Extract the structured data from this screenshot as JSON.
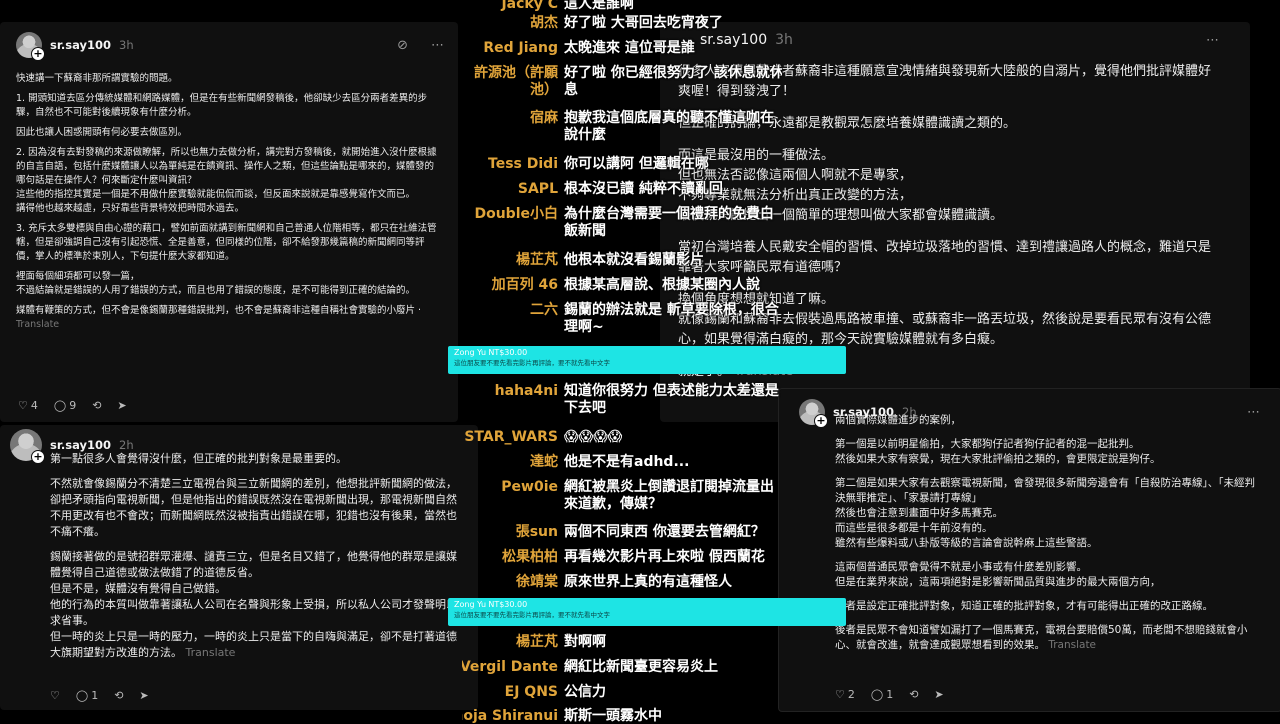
{
  "post_left_top": {
    "username": "sr.say100",
    "time": "3h",
    "paragraphs": [
      "快速講一下蘇裔非那所謂實驗的問題。",
      "1. 開頭知道去區分傳統媒體和網路媒體，但是在有些新聞網發稿後，他卻缺少去區分兩者差異的步驟，自然也不可能對後續現象有什麼分析。",
      "因此也讓人困惑開頭有何必要去做區別。",
      "2. 因為沒有去對發稿的來源做瞭解，所以也無力去做分析，講完對方發稿後，就開始進入沒什麼根據的自言自語，包括什麼媒體讓人以為單純是在饋資訊、操作人之類，但這些論點是哪來的，媒體發的哪句話是在操作人？何來斷定什麼叫資訊？\n這些他的指控其實是一個是不用做什麼實驗就能侃侃而談，但反面來說就是靠感覺寫作文而已。\n講得他也越來越虛，只好靠些背景特效把時間水過去。",
      "3. 充斥太多雙標與自由心證的藉口，譬如前面就講到新聞網和自己普通人位階相等，都只在社維法管轄，但是卻強調自己沒有引起恐慌、全是善意，但同樣的位階，卻不給發那幾篇稿的新聞網同等評價，掌人的標準於束別人，下句提什麼大家都知道。",
      "裡面每個細項都可以發一篇，\n不過結論就是錯誤的人用了錯誤的方式，而且也用了錯誤的態度，是不可能得到正確的結論的。",
      "媒體有鞭策的方式，但不會是像錫蘭那種錯誤批判，也不會是蘇裔非這種自稱社會實驗的小廢片"
    ],
    "translate": "Translate",
    "likes": "4",
    "comments": "9"
  },
  "post_left_bottom": {
    "username": "sr.say100",
    "time": "2h",
    "paragraphs": [
      "第一點很多人會覺得沒什麼，但正確的批判對象是最重要的。",
      "不然就會像錫蘭分不清楚三立電視台與三立新聞網的差別，他想批評新聞網的做法，卻把矛頭指向電視新聞，但是他指出的錯誤既然沒在電視新聞出現，那電視新聞自然不用更改有也不會改；而新聞網既然沒被指責出錯誤在哪，犯錯也沒有後果，當然也不痛不癢。",
      "錫蘭接著做的是號招群眾灌爆、譴責三立，但是名目又錯了，他覺得他的群眾是讓媒體覺得自己道德或做法做錯了的道德反省。\n但是不是，媒體沒有覺得自己做錯。\n他的行為的本質叫做靠著讓私人公司在名聲與形象上受損，所以私人公司才發聲明以求省事。\n但一時的炎上只是一時的壓力，一時的炎上只是當下的自嗨與滿足，卻不是打著道德大旗期望對方改進的方法。"
    ],
    "translate": "Translate",
    "comments": "1"
  },
  "post_mid": {
    "username": "sr.say100",
    "time": "3h",
    "paragraphs": [
      "很多人宣傳錫蘭或者蘇裔非這種願意宣洩情緒與發現新大陸般的自溺片，覺得他們批評媒體好爽喔！得到發洩了！",
      "但正確的討論，永遠都是教觀眾怎麼培養媒體識讀之類的。",
      "而這是最沒用的一種做法。\n但也無法否認像這兩個人啊就不是專家，\n不夠專業就無法分析出真正改變的方法，\n最後就只能提出一個簡單的理想叫做大家都會媒體識讀。",
      "當初台灣培養人民戴安全帽的習慣、改掉垃圾落地的習慣、達到禮讓過路人的概念，難道只是靠著大家呼籲民眾有道德嗎？",
      "換個角度想想就知道了嘛。\n就像錫蘭和蘇裔非去假裝過馬路被車撞、或蘇裔非一路丟垃圾，然後說是要看民眾有沒有公德心，如果覺得滿白癡的，那今天說實驗媒體就有多白癡。",
      "就是了。"
    ],
    "translate": "Translate"
  },
  "post_right": {
    "username": "sr.say100",
    "time": "2h",
    "paragraphs": [
      "兩個實際媒體進步的案例，",
      "第一個是以前明星偷拍，大家都狗仔記者狗仔記者的混一起批判。\n然後如果大家有察覺，現在大家批評偷拍之類的，會更限定說是狗仔。",
      "第二個是如果大家有去觀察電視新聞，會發現很多新聞旁邊會有「自殺防治專線」、「未經判決無罪推定」、「家暴請打專線」\n然後也會注意到畫面中好多馬賽克。\n而這些是很多都是十年前沒有的。\n雖然有些爆料或八卦版等級的言論會說幹麻上這些警語。",
      "這兩個普通民眾會覺得不就是小事或有什麼差別影響。\n但是在業界來說，這兩項絕對是影響新聞品質與進步的最大兩個方向，",
      "後者是設定正確批評對象，知道正確的批評對象，才有可能得出正確的改正路線。",
      "後者是民眾不會知道譬如漏打了一個馬賽克，電視台要賠償50萬，而老闆不想賠錢就會小心、就會改進，就會達成觀眾想看到的效果。"
    ],
    "translate": "Translate",
    "likes": "2",
    "comments": "1"
  },
  "chat": [
    {
      "name": "Jacky C",
      "text": "這人是誰啊"
    },
    {
      "name": "胡杰",
      "text": "好了啦 大哥回去吃宵夜了"
    },
    {
      "name": "Red Jiang",
      "text": "太晚進來 這位哥是誰"
    },
    {
      "name": "許源池（許願池）",
      "text": "好了啦 你已經很努力了 該休息就休息"
    },
    {
      "name": "宿麻",
      "text": "抱歉我這個底層真的聽不懂這咖在說什麼"
    },
    {
      "name": "Tess Didi",
      "text": "你可以講阿 但邏輯在哪"
    },
    {
      "name": "SAPL",
      "text": "根本沒已讀 純粹不讀亂回"
    },
    {
      "name": "Double小白",
      "text": "為什麼台灣需要一個禮拜的免費白飯新聞"
    },
    {
      "name": "楊芷芃",
      "text": "他根本就沒看錫蘭影片"
    },
    {
      "name": "加百列 46",
      "text": "根據某高層說、根據某圈內人說"
    },
    {
      "name": "二六",
      "text": "錫蘭的辦法就是 斬草要除根，很合理啊~"
    },
    {
      "name": "haha4ni",
      "text": "知道你很努力 但表述能力太差還是下去吧"
    },
    {
      "name": "STAR_WARS",
      "text": "😱😱😱😱"
    },
    {
      "name": "達蛇",
      "text": "他是不是有adhd..."
    },
    {
      "name": "Pew0ie",
      "text": "網紅被黑炎上倒讚退訂閱掉流量出來道歉，傳媒？"
    },
    {
      "name": "張sun",
      "text": "兩個不同東西 你還要去管網紅？"
    },
    {
      "name": "松果柏柏",
      "text": "再看幾次影片再上來啦 假西蘭花"
    },
    {
      "name": "徐靖棠",
      "text": "原來世界上真的有這種怪人"
    },
    {
      "name": "楊芷芃",
      "text": "對啊啊"
    },
    {
      "name": "Vergil Dante",
      "text": "網紅比新聞臺更容易炎上"
    },
    {
      "name": "EJ QNS",
      "text": "公信力"
    },
    {
      "name": "Choja Shiranui",
      "text": "斯斯一頭霧水中"
    }
  ],
  "superchats": [
    {
      "who": "Zong Yu",
      "amount": "NT$30.00",
      "msg": "這位朋友要不要先看完影片再評論，要不就先看中文字"
    },
    {
      "who": "Zong Yu",
      "amount": "NT$30.00",
      "msg": "這位朋友要不要先看完影片再評論，要不就先看中文字"
    }
  ],
  "colors": {
    "card": "#101010",
    "chat_name": "#e0a43a",
    "superchat": "#1ee4e4"
  }
}
